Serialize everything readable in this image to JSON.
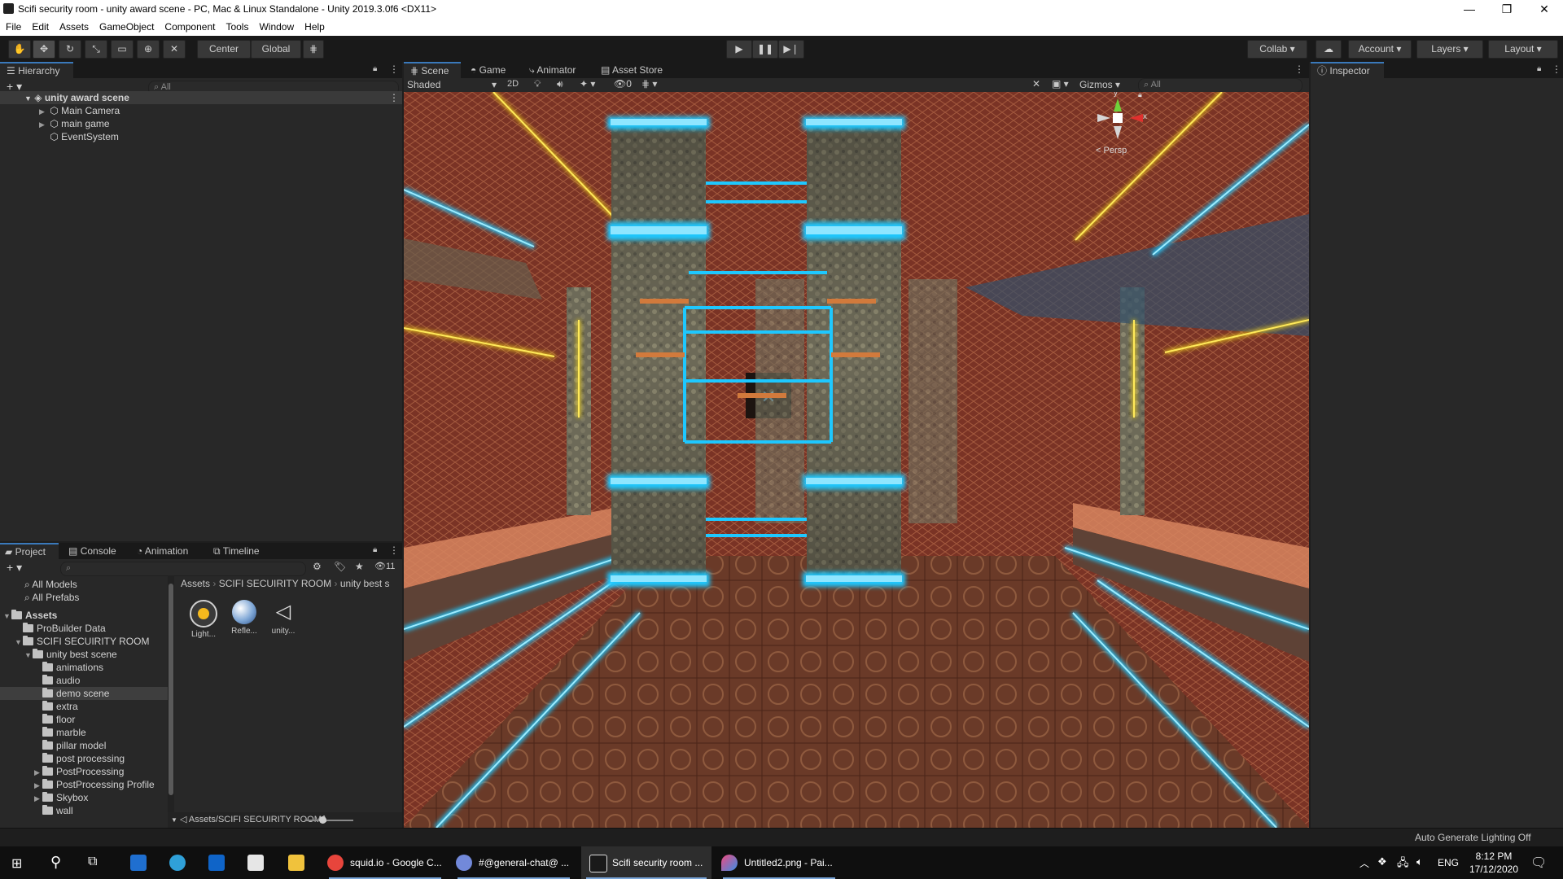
{
  "window": {
    "title": "Scifi security room - unity award scene - PC, Mac & Linux Standalone - Unity 2019.3.0f6 <DX11>",
    "controls": [
      "—",
      "❐",
      "✕"
    ]
  },
  "menu": [
    "File",
    "Edit",
    "Assets",
    "GameObject",
    "Component",
    "Tools",
    "Window",
    "Help"
  ],
  "toolbar": {
    "pivot": "Center",
    "space": "Global",
    "collab": "Collab",
    "account": "Account",
    "layers": "Layers",
    "layout": "Layout"
  },
  "hierarchy": {
    "tab": "Hierarchy",
    "search_placeholder": "All",
    "scene": "unity award scene",
    "items": [
      "Main Camera",
      "main game",
      "EventSystem"
    ]
  },
  "scene_view": {
    "tabs": [
      "Scene",
      "Game",
      "Animator",
      "Asset Store"
    ],
    "shading": "Shaded",
    "mode_2d": "2D",
    "hidden_count": "0",
    "gizmos": "Gizmos",
    "search_placeholder": "All",
    "persp": "Persp",
    "axis_x": "x",
    "axis_y": "y"
  },
  "inspector": {
    "tab": "Inspector"
  },
  "project": {
    "tabs": [
      "Project",
      "Console",
      "Animation",
      "Timeline"
    ],
    "favorites": [
      "All Models",
      "All Prefabs"
    ],
    "badge_count": "11",
    "tree_root": "Assets",
    "tree": [
      {
        "label": "ProBuilder Data",
        "depth": 1,
        "arrow": ""
      },
      {
        "label": "SCIFI SECUIRITY ROOM",
        "depth": 1,
        "arrow": "▼"
      },
      {
        "label": "unity best scene",
        "depth": 2,
        "arrow": "▼"
      },
      {
        "label": "animations",
        "depth": 3,
        "arrow": ""
      },
      {
        "label": "audio",
        "depth": 3,
        "arrow": ""
      },
      {
        "label": "demo scene",
        "depth": 3,
        "arrow": ""
      },
      {
        "label": "extra",
        "depth": 3,
        "arrow": ""
      },
      {
        "label": "floor",
        "depth": 3,
        "arrow": ""
      },
      {
        "label": "marble",
        "depth": 3,
        "arrow": ""
      },
      {
        "label": "pillar model",
        "depth": 3,
        "arrow": ""
      },
      {
        "label": "post processing",
        "depth": 3,
        "arrow": ""
      },
      {
        "label": "PostProcessing",
        "depth": 3,
        "arrow": "▶"
      },
      {
        "label": "PostProcessing Profile",
        "depth": 3,
        "arrow": "▶"
      },
      {
        "label": "Skybox",
        "depth": 3,
        "arrow": "▶"
      },
      {
        "label": "wall",
        "depth": 3,
        "arrow": ""
      }
    ],
    "selected_index": 5,
    "breadcrumb": [
      "Assets",
      "SCIFI SECUIRITY ROOM",
      "unity best s"
    ],
    "assets": [
      "Light...",
      "Refle...",
      "unity..."
    ],
    "path": "Assets/SCIFI SECUIRITY ROOM/\\"
  },
  "status": {
    "lighting": "Auto Generate Lighting Off"
  },
  "taskbar": {
    "apps": [
      "squid.io - Google C...",
      "#@general-chat@ ...",
      "Scifi security room ...",
      "Untitled2.png - Pai..."
    ],
    "lang": "ENG",
    "time": "8:12 PM",
    "date": "17/12/2020"
  },
  "colors": {
    "neon_cyan": "#1ec8ff",
    "neon_yellow": "#f2d41a",
    "brick": "#8a3b2a",
    "accent": "#3a79bb"
  }
}
